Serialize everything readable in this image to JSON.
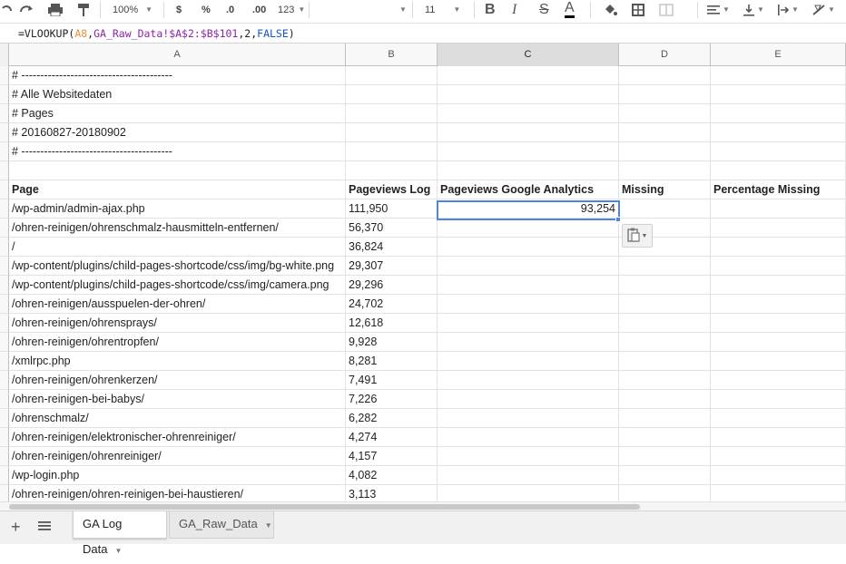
{
  "toolbar": {
    "zoom": "100%",
    "currency": "$",
    "percent": "%",
    "dec_less": ".0",
    "dec_more": ".00",
    "more_formats": "123",
    "font_size": "11",
    "bold": "B",
    "italic": "I",
    "strike": "S",
    "text_color": "A"
  },
  "formula_bar": {
    "prefix": "=VLOOKUP(",
    "ref1": "A8",
    "sep1": ",",
    "ref2": "GA_Raw_Data!$A$2:$B$101",
    "sep2": ",2,",
    "kw": "FALSE",
    "suffix": ")"
  },
  "columns": [
    "A",
    "B",
    "C",
    "D",
    "E"
  ],
  "rows": [
    {
      "A": "# ----------------------------------------",
      "B": "",
      "C": "",
      "D": "",
      "E": ""
    },
    {
      "A": "# Alle Websitedaten",
      "B": "",
      "C": "",
      "D": "",
      "E": ""
    },
    {
      "A": "# Pages",
      "B": "",
      "C": "",
      "D": "",
      "E": ""
    },
    {
      "A": "# 20160827-20180902",
      "B": "",
      "C": "",
      "D": "",
      "E": ""
    },
    {
      "A": "# ----------------------------------------",
      "B": "",
      "C": "",
      "D": "",
      "E": ""
    },
    {
      "A": "",
      "B": "",
      "C": "",
      "D": "",
      "E": ""
    },
    {
      "A": "Page",
      "B": "Pageviews Log",
      "C": "Pageviews Google Analytics",
      "D": "Missing",
      "E": "Percentage Missing"
    },
    {
      "A": "/wp-admin/admin-ajax.php",
      "B": "111,950",
      "C": "93,254",
      "D": "",
      "E": ""
    },
    {
      "A": "/ohren-reinigen/ohrenschmalz-hausmitteln-entfernen/",
      "B": "56,370",
      "C": "",
      "D": "",
      "E": ""
    },
    {
      "A": "/",
      "B": "36,824",
      "C": "",
      "D": "",
      "E": ""
    },
    {
      "A": "/wp-content/plugins/child-pages-shortcode/css/img/bg-white.png",
      "B": "29,307",
      "C": "",
      "D": "",
      "E": ""
    },
    {
      "A": "/wp-content/plugins/child-pages-shortcode/css/img/camera.png",
      "B": "29,296",
      "C": "",
      "D": "",
      "E": ""
    },
    {
      "A": "/ohren-reinigen/ausspuelen-der-ohren/",
      "B": "24,702",
      "C": "",
      "D": "",
      "E": ""
    },
    {
      "A": "/ohren-reinigen/ohrensprays/",
      "B": "12,618",
      "C": "",
      "D": "",
      "E": ""
    },
    {
      "A": "/ohren-reinigen/ohrentropfen/",
      "B": "9,928",
      "C": "",
      "D": "",
      "E": ""
    },
    {
      "A": "/xmlrpc.php",
      "B": "8,281",
      "C": "",
      "D": "",
      "E": ""
    },
    {
      "A": "/ohren-reinigen/ohrenkerzen/",
      "B": "7,491",
      "C": "",
      "D": "",
      "E": ""
    },
    {
      "A": "/ohren-reinigen-bei-babys/",
      "B": "7,226",
      "C": "",
      "D": "",
      "E": ""
    },
    {
      "A": "/ohrenschmalz/",
      "B": "6,282",
      "C": "",
      "D": "",
      "E": ""
    },
    {
      "A": "/ohren-reinigen/elektronischer-ohrenreiniger/",
      "B": "4,274",
      "C": "",
      "D": "",
      "E": ""
    },
    {
      "A": "/ohren-reinigen/ohrenreiniger/",
      "B": "4,157",
      "C": "",
      "D": "",
      "E": ""
    },
    {
      "A": "/wp-login.php",
      "B": "4,082",
      "C": "",
      "D": "",
      "E": ""
    },
    {
      "A": "/ohren-reinigen/ohren-reinigen-bei-haustieren/",
      "B": "3,113",
      "C": "",
      "D": "",
      "E": ""
    }
  ],
  "sheets": [
    {
      "label": "GA Log Data",
      "active": true
    },
    {
      "label": "GA_Raw_Data",
      "active": false
    }
  ],
  "colors": {
    "selection": "#4a86e8"
  }
}
